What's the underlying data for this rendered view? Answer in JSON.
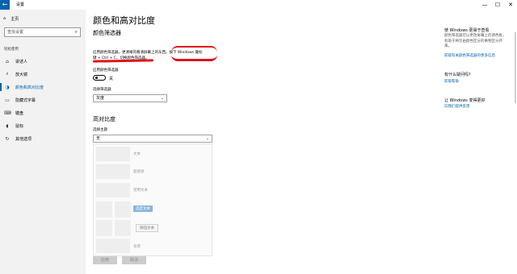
{
  "window": {
    "title": "设置",
    "back_icon": "back-arrow-icon",
    "controls": {
      "minimize": "—",
      "maximize": "☐",
      "close": "✕"
    }
  },
  "sidebar": {
    "home_label": "主页",
    "search_placeholder": "查找设置",
    "section_title": "轻松使用",
    "items": [
      {
        "label": "讲述人",
        "icon": "narrator-icon",
        "glyph": "⌂",
        "active": false
      },
      {
        "label": "放大镜",
        "icon": "magnifier-icon",
        "glyph": "⌕",
        "active": false
      },
      {
        "label": "颜色和高对比度",
        "icon": "color-contrast-icon",
        "glyph": "◑",
        "active": true
      },
      {
        "label": "隐藏式字幕",
        "icon": "closed-captions-icon",
        "glyph": "▭",
        "active": false
      },
      {
        "label": "键盘",
        "icon": "keyboard-icon",
        "glyph": "⌨",
        "active": false
      },
      {
        "label": "鼠标",
        "icon": "mouse-icon",
        "glyph": "◖",
        "active": false
      },
      {
        "label": "其他选项",
        "icon": "other-options-icon",
        "glyph": "↻",
        "active": false
      }
    ]
  },
  "main": {
    "page_title": "颜色和高对比度",
    "color_filter_heading": "颜色筛选器",
    "desc_line1a": "应用颜色筛选器，更清晰的看清屏幕上的东西。",
    "desc_line1b": "按下 Windows 徽标",
    "desc_line2": "键 + Ctrl + C，切换颜色筛选器。",
    "apply_filter_label": "应用颜色筛选器",
    "toggle_state": "关",
    "toggle_on": false,
    "choose_filter_label": "选择筛选器",
    "choose_filter_value": "灰度",
    "high_contrast_heading": "高对比度",
    "choose_theme_label": "选择主题",
    "choose_theme_value": "无",
    "preview": {
      "text": "文本",
      "hyperlink": "超链接",
      "disabled_text": "禁用文本",
      "selected_text": "选定文本",
      "button_text": "按钮文本",
      "background": "背景"
    },
    "apply_button": "应用",
    "cancel_button": "取消"
  },
  "right": {
    "updated_heading": "使 Windows 更易于查看",
    "updated_body": "颜色筛选器可以更改屏幕上的调色板，有助于将仅由颜色区分的事物区分开来。",
    "updated_link": "获取有关颜色筛选器的更多信息",
    "question_heading": "有什么疑问吗?",
    "question_link": "获取帮助",
    "improve_heading": "让 Windows 变得更好",
    "improve_link": "向我们提供反馈"
  }
}
